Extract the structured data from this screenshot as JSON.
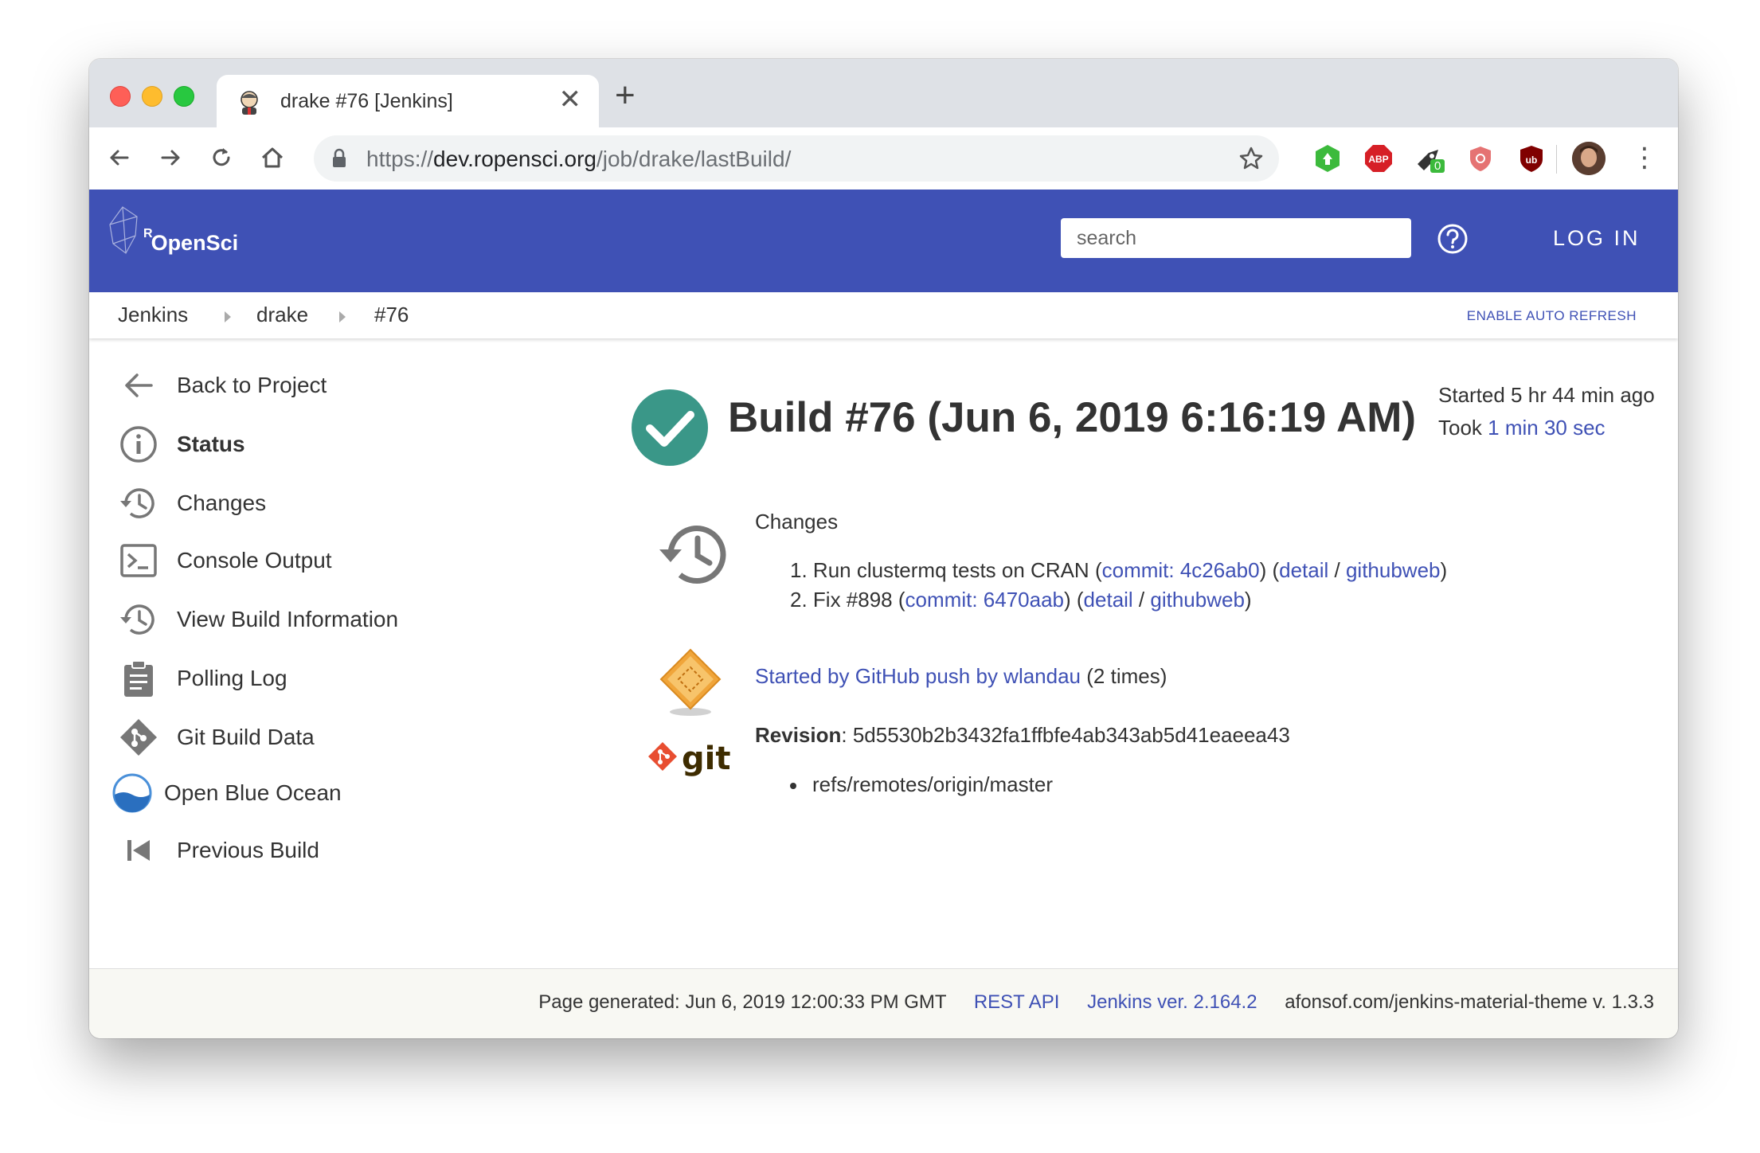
{
  "browser": {
    "tab_title": "drake #76 [Jenkins]",
    "new_tab": "+",
    "close": "✕",
    "url_scheme": "https://",
    "url_host": "dev.ropensci.org",
    "url_path": "/job/drake/lastBuild/",
    "extension_badge": "0",
    "abp_label": "ABP"
  },
  "header": {
    "logo_text": "OpenSci",
    "logo_prefix": "R",
    "search_placeholder": "search",
    "login_label": "LOG IN"
  },
  "breadcrumb": {
    "items": [
      "Jenkins",
      "drake",
      "#76"
    ],
    "auto_refresh": "ENABLE AUTO REFRESH"
  },
  "sidebar": {
    "items": [
      {
        "label": "Back to Project",
        "icon": "arrow-left-icon"
      },
      {
        "label": "Status",
        "icon": "info-icon"
      },
      {
        "label": "Changes",
        "icon": "history-icon"
      },
      {
        "label": "Console Output",
        "icon": "terminal-icon"
      },
      {
        "label": "View Build Information",
        "icon": "history-icon"
      },
      {
        "label": "Polling Log",
        "icon": "clipboard-icon"
      },
      {
        "label": "Git Build Data",
        "icon": "git-icon"
      },
      {
        "label": "Open Blue Ocean",
        "icon": "blue-ocean-icon"
      },
      {
        "label": "Previous Build",
        "icon": "skip-previous-icon"
      }
    ]
  },
  "build": {
    "title": "Build #76 (Jun 6, 2019 6:16:19 AM)",
    "started_label": "Started 5 hr 44 min ago",
    "took_label": "Took",
    "took_value": "1 min 30 sec",
    "changes_heading": "Changes",
    "changes": [
      {
        "num": "1.",
        "text": "Run clustermq tests on CRAN",
        "commit": "commit: 4c26ab0",
        "detail": "detail",
        "web": "githubweb"
      },
      {
        "num": "2.",
        "text": "Fix #898",
        "commit": "commit: 6470aab",
        "detail": "detail",
        "web": "githubweb"
      }
    ],
    "started_by_link": "Started by GitHub push by wlandau",
    "started_by_suffix": "(2 times)",
    "revision_label": "Revision",
    "revision_value": "5d5530b2b3432fa1ffbfe4ab343ab5d41eaeea43",
    "branch": "refs/remotes/origin/master",
    "git_logo_text": "git"
  },
  "footer": {
    "generated": "Page generated: Jun 6, 2019 12:00:33 PM GMT",
    "rest_api": "REST API",
    "jenkins_version": "Jenkins ver. 2.164.2",
    "theme": "afonsof.com/jenkins-material-theme v. 1.3.3"
  },
  "colors": {
    "header_bg": "#3f51b5",
    "link": "#3f51b5",
    "success": "#3a9788"
  }
}
